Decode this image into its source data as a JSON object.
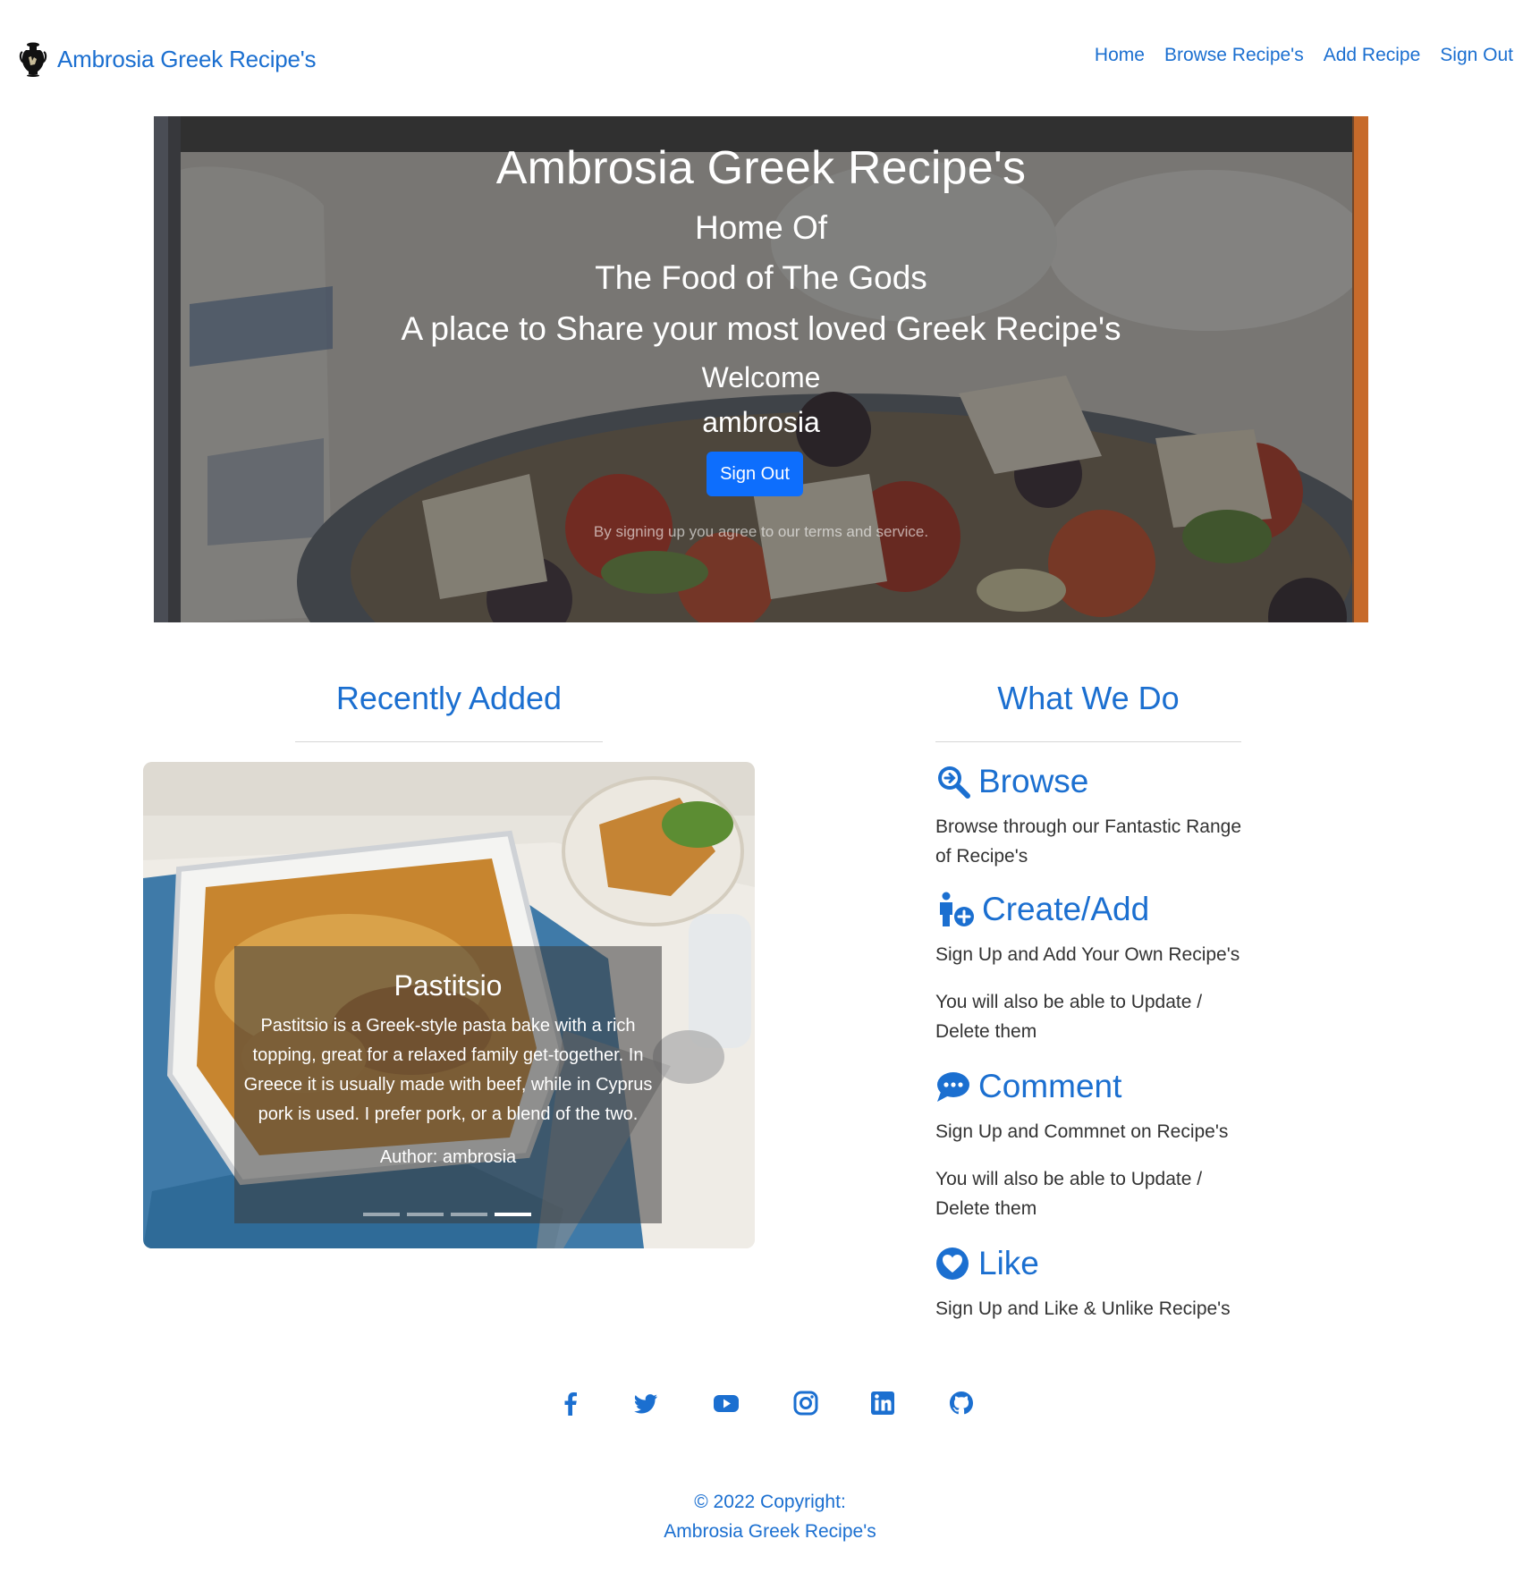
{
  "navbar": {
    "brand": "Ambrosia Greek Recipe's",
    "links": [
      "Home",
      "Browse Recipe's",
      "Add Recipe",
      "Sign Out"
    ]
  },
  "hero": {
    "title": "Ambrosia Greek Recipe's",
    "line1": "Home Of",
    "line2": "The Food of The Gods",
    "line3": "A place to Share your most loved Greek Recipe's",
    "welcome": "Welcome",
    "username": "ambrosia",
    "button": "Sign Out",
    "note": "By signing up you agree to our terms and service."
  },
  "recent": {
    "heading": "Recently Added",
    "slide": {
      "title": "Pastitsio",
      "text": "Pastitsio is a Greek-style pasta bake with a rich topping, great for a relaxed family get-together. In Greece it is usually made with beef, while in Cyprus pork is used. I prefer pork, or a blend of the two.",
      "author": "Author: ambrosia"
    },
    "indicator_count": 4,
    "active_indicator": 4
  },
  "what_we_do": {
    "heading": "What We Do",
    "browse": {
      "title": "Browse",
      "text": "Browse through our Fantastic Range of Recipe's",
      "icon": "search-arrow-icon"
    },
    "create": {
      "title": "Create/Add",
      "text": "Sign Up and Add Your Own Recipe's",
      "text2": "You will also be able to Update / Delete them",
      "icon": "person-plus-icon"
    },
    "comment": {
      "title": "Comment",
      "text": "Sign Up and Commnet on Recipe's",
      "text2": "You will also be able to Update / Delete them",
      "icon": "comment-dots-icon"
    },
    "like": {
      "title": "Like",
      "text": "Sign Up and Like & Unlike Recipe's",
      "icon": "heart-circle-icon"
    }
  },
  "social": [
    "facebook-icon",
    "twitter-icon",
    "youtube-icon",
    "instagram-icon",
    "linkedin-icon",
    "github-icon"
  ],
  "footer": {
    "copyright": "© 2022 Copyright:",
    "site": "Ambrosia Greek Recipe's"
  },
  "colors": {
    "link": "#1b6fd0",
    "button": "#0d6efd"
  }
}
